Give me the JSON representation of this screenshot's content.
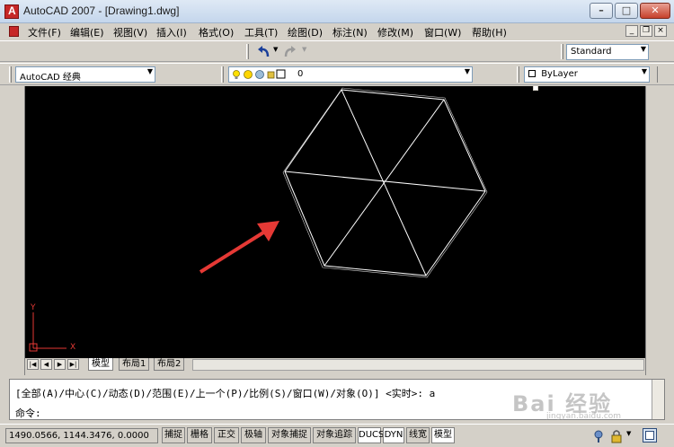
{
  "window": {
    "title": "AutoCAD 2007 - [Drawing1.dwg]"
  },
  "menu": [
    "文件(F)",
    "编辑(E)",
    "视图(V)",
    "插入(I)",
    "格式(O)",
    "工具(T)",
    "绘图(D)",
    "标注(N)",
    "修改(M)",
    "窗口(W)",
    "帮助(H)"
  ],
  "toolbar": {
    "text_style": "Standard",
    "workspace": "AutoCAD 经典",
    "layer": "0",
    "color": "ByLayer"
  },
  "ucs": {
    "x_label": "X",
    "y_label": "Y"
  },
  "tabs": [
    "模型",
    "布局1",
    "布局2"
  ],
  "command": {
    "history": "[全部(A)/中心(C)/动态(D)/范围(E)/上一个(P)/比例(S)/窗口(W)/对象(O)] <实时>: a",
    "prompt": "命令:"
  },
  "status": {
    "coords": "1490.0566,  1144.3476,  0.0000",
    "buttons": [
      {
        "label": "捕捉",
        "on": false
      },
      {
        "label": "栅格",
        "on": false
      },
      {
        "label": "正交",
        "on": false
      },
      {
        "label": "极轴",
        "on": false
      },
      {
        "label": "对象捕捉",
        "on": false
      },
      {
        "label": "对象追踪",
        "on": false
      },
      {
        "label": "DUCS",
        "on": true
      },
      {
        "label": "DYN",
        "on": true
      },
      {
        "label": "线宽",
        "on": false
      },
      {
        "label": "模型",
        "on": true
      }
    ]
  },
  "watermark": {
    "main": "Bai 经验",
    "sub": "jingyan.baidu.com"
  },
  "colors": {
    "canvas": "#000000",
    "geometry": "#ffffff",
    "arrow": "#e53935",
    "ucs": "#e53935"
  }
}
